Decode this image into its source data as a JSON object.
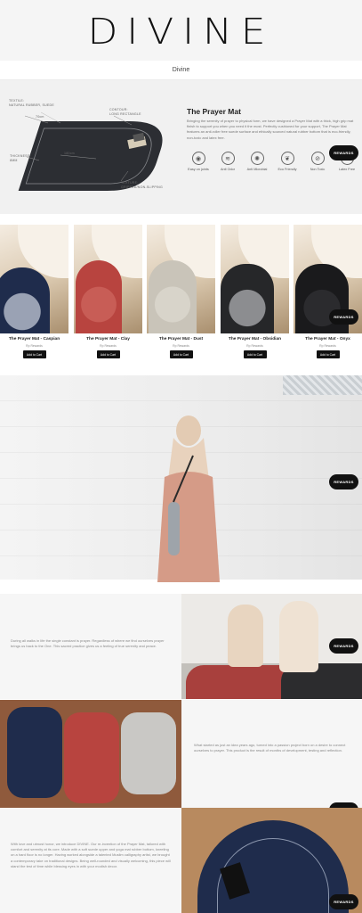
{
  "brand": {
    "logo": "DIVINE",
    "subnav": "Divine"
  },
  "hero": {
    "title": "The Prayer Mat",
    "description": "Bringing the serenity of prayer to physical form, we have designed a Prayer Mat with a thick, high grip mat finish to support you when you need it the most. Perfectly cushioned for your support, The Prayer Mat features an anti-roller free suede surface and ethically sourced natural rubber bottom that is eco-friendly, non-toxic and latex free.",
    "callouts": {
      "textile": "TEXTILE:\nNATURAL RUBBER, SUEDE",
      "contour": "CONTOUR:\nLONG RECTANGLE",
      "thickness": "THICKNESS:\n8MM",
      "texture": "TEXTURE:\nGRIPPED/NON-SLIPPING",
      "width": "70cm",
      "length": "180cm"
    },
    "features": [
      {
        "icon": "pressure-point-icon",
        "label": "Easy on joints"
      },
      {
        "icon": "odor-icon",
        "label": "Anti Odor"
      },
      {
        "icon": "microbial-icon",
        "label": "Anti Microbial"
      },
      {
        "icon": "leaf-icon",
        "label": "Eco Friendly"
      },
      {
        "icon": "non-toxic-icon",
        "label": "Non Toxic"
      },
      {
        "icon": "latex-icon",
        "label": "Latex Free"
      }
    ]
  },
  "rewards_label": "REWARDS",
  "products": [
    {
      "title": "The Prayer Mat - Caspian",
      "price": "Rp Rewards",
      "button": "Add to Cart",
      "mat_color": "#1f2c4c",
      "mat_pattern": "#9aa2b4"
    },
    {
      "title": "The Prayer Mat - Clay",
      "price": "Rp Rewards",
      "button": "Add to Cart",
      "mat_color": "#b8443f",
      "mat_pattern": "#c85d56"
    },
    {
      "title": "The Prayer Mat - Dust",
      "price": "Rp Rewards",
      "button": "Add to Cart",
      "mat_color": "#c9c4b9",
      "mat_pattern": "#d8d4ca"
    },
    {
      "title": "The Prayer Mat - Obsidian",
      "price": "Rp Rewards",
      "button": "Add to Cart",
      "mat_color": "#262729",
      "mat_pattern": "#8c8d90"
    },
    {
      "title": "The Prayer Mat - Onyx",
      "price": "Rp Rewards",
      "button": "Add to Cart",
      "mat_color": "#1a1a1c",
      "mat_pattern": "#2b2b2e"
    }
  ],
  "stories": [
    {
      "text": "During all walks in life the single constant is prayer. Regardless of where we find ourselves prayer brings us back to the One. This sacred practice gives us a feeling of true serenity and peace."
    },
    {
      "text": "What started as just an idea years ago, turned into a passion project born on a desire to connect ourselves to prayer. This product is the result of months of development, testing and reflection."
    },
    {
      "text": "With love and utmost honor, we introduce DIVINE. Our re-invention of the Prayer Mat, tailored with comfort and serenity at its core. Made with a soft suede upper and yoga mat rubber bottom, kneeling on a hard floor is no longer. Having worked alongside a talented Muslim calligraphy artist, we brought a contemporary take on traditional designs. Being well-rounded and visually welcoming, this piece will stand the test of time while blessing eyes in with your modish decor."
    }
  ]
}
